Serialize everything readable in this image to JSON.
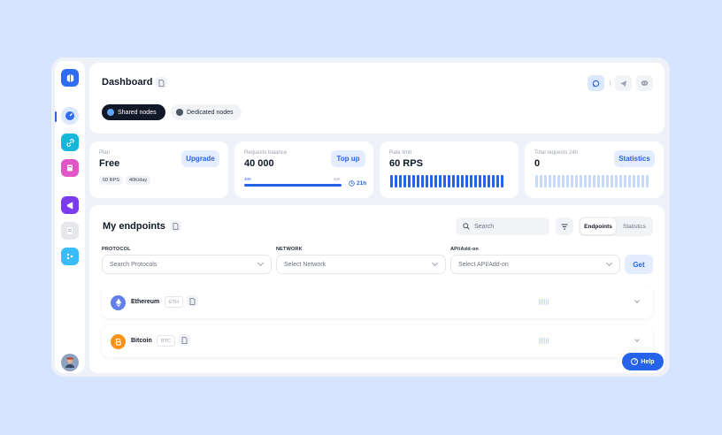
{
  "header": {
    "title": "Dashboard",
    "tabs": [
      {
        "label": "Shared nodes",
        "active": true
      },
      {
        "label": "Dedicated nodes",
        "active": false
      }
    ]
  },
  "stats": {
    "plan": {
      "label": "Plan",
      "value": "Free",
      "button": "Upgrade",
      "tags": [
        "60 RPS",
        "40K/day"
      ]
    },
    "balance": {
      "label": "Requests balance",
      "value": "40 000",
      "button": "Top up",
      "bar_start": "40K",
      "bar_end": "40K",
      "progress": 1.0,
      "timer": "21h"
    },
    "rate": {
      "label": "Rate limit",
      "value": "60 RPS"
    },
    "total": {
      "label": "Total requests 24h",
      "value": "0",
      "button": "Statistics"
    }
  },
  "endpoints": {
    "title": "My endpoints",
    "search_placeholder": "Search",
    "toggle": [
      {
        "label": "Endpoints",
        "active": true
      },
      {
        "label": "Statistics",
        "active": false
      }
    ],
    "filters": {
      "protocol": {
        "label": "PROTOCOL",
        "placeholder": "Search Protocols"
      },
      "network": {
        "label": "NETWORK",
        "placeholder": "Select Network"
      },
      "api": {
        "label": "API/Add-on",
        "placeholder": "Select API/Add-on"
      }
    },
    "get_button": "Get",
    "rows": [
      {
        "name": "Ethereum",
        "ticker": "ETH",
        "icon": "ethereum-icon",
        "color": "#627eea"
      },
      {
        "name": "Bitcoin",
        "ticker": "BTC",
        "icon": "bitcoin-icon",
        "color": "#f7931a"
      }
    ]
  },
  "help_button": "Help",
  "colors": {
    "accent": "#2563eb",
    "bar_light": "#c7dafc",
    "background": "#d6e4fd"
  }
}
